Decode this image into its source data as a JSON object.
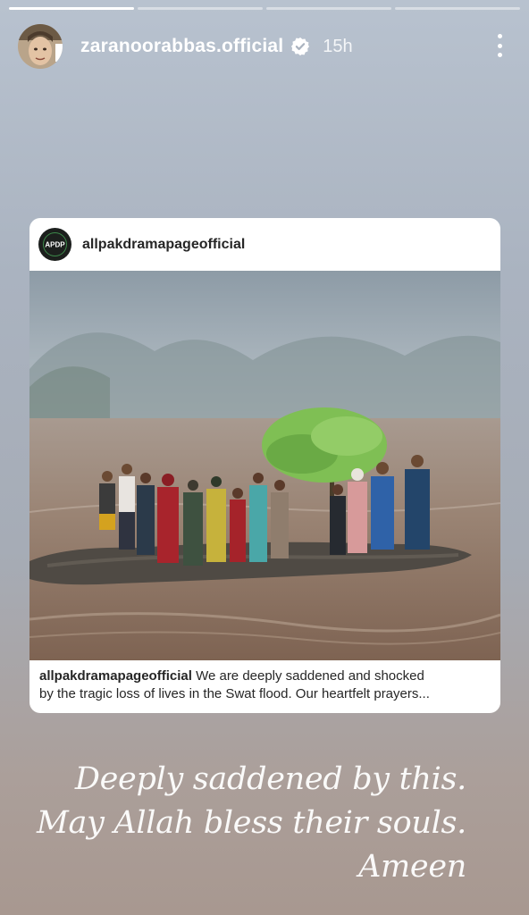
{
  "story": {
    "progress_segments": 4,
    "active_segment": 1,
    "username": "zaranoorabbas.official",
    "verified": true,
    "time_ago": "15h",
    "more_icon": "more-vertical-icon"
  },
  "shared_post": {
    "username": "allpakdramapageofficial",
    "logo_text": "APDP",
    "caption_user": "allpakdramapageofficial",
    "caption_line1": " We are deeply saddened and shocked",
    "caption_line2": "by the tragic loss of lives in the Swat flood. Our heartfelt prayers..."
  },
  "overlay_text": {
    "line1": "Deeply saddened by this.",
    "line2": "May Allah bless their souls.",
    "line3": "Ameen"
  },
  "colors": {
    "background_top": "#b8c2cf",
    "background_bottom": "#a89890",
    "text": "#ffffff",
    "card": "#ffffff",
    "flood_water": "#8a7060"
  }
}
